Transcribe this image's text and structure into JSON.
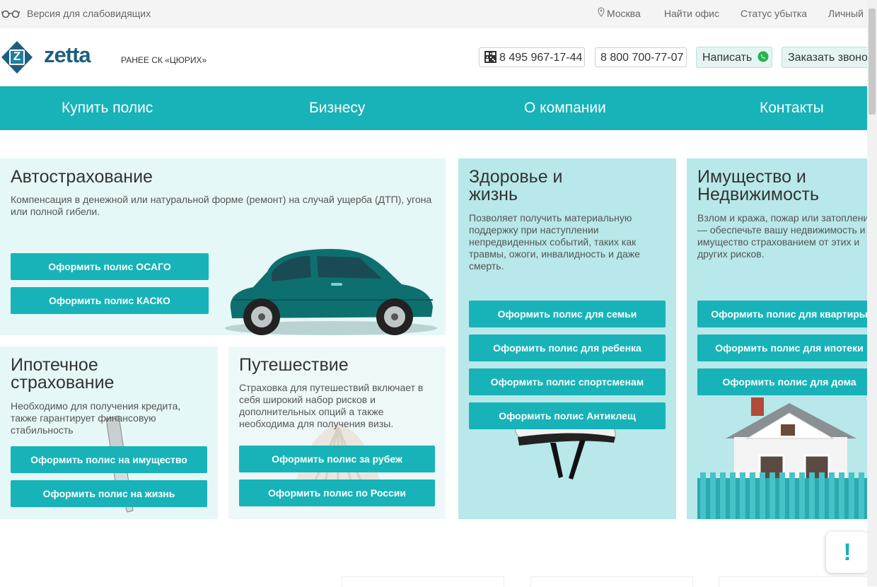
{
  "topbar": {
    "accessibility_label": "Версия для слабовидящих",
    "city": "Москва",
    "find_office": "Найти офис",
    "claim_status": "Статус убытка",
    "personal": "Личный"
  },
  "header": {
    "logo_text": "zetta",
    "logo_mark": "Z",
    "former_name": "РАНЕЕ СК «ЦЮРИХ»",
    "phone1": "8 495 967-17-44",
    "phone2": "8 800 700-77-07",
    "write_label": "Написать",
    "callback_label": "Заказать звонок"
  },
  "nav": {
    "items": [
      "Купить полис",
      "Бизнесу",
      "О компании",
      "Контакты"
    ]
  },
  "auto": {
    "title": "Автострахование",
    "desc": "Компенсация в денежной или натуральной форме (ремонт) на случай ущерба (ДТП), угона или полной гибели.",
    "btn1": "Оформить полис ОСАГО",
    "btn2": "Оформить полис КАСКО"
  },
  "health": {
    "title_line1": "Здоровье и",
    "title_line2": "жизнь",
    "desc": "Позволяет получить материальную поддержку при наступлении непредвиденных событий, таких как травмы, ожоги, инвалидность и даже смерть.",
    "btn1": "Оформить полис для семьи",
    "btn2": "Оформить полис для ребенка",
    "btn3": "Оформить полис спортсменам",
    "btn4": "Оформить полис Антиклещ"
  },
  "property": {
    "title_line1": "Имущество и",
    "title_line2": "Недвижимость",
    "desc": "Взлом и кража, пожар или затопление — обеспечьте вашу недвижимость и имущество страхованием от этих и других рисков.",
    "btn1": "Оформить полис для квартиры",
    "btn2": "Оформить полис для ипотеки",
    "btn3": "Оформить полис для дома"
  },
  "mortgage": {
    "title_line1": "Ипотечное",
    "title_line2": "страхование",
    "desc": "Необходимо для получения кредита, также гарантирует финансовую стабильность",
    "btn1": "Оформить полис на имущество",
    "btn2": "Оформить полис на жизнь"
  },
  "travel": {
    "title": "Путешествие",
    "desc": "Страховка для путешествий включает в себя широкий набор рисков и дополнительных опций а также необходима для получения визы.",
    "btn1": "Оформить полис за рубеж",
    "btn2": "Оформить полис по России"
  },
  "feedback_widget": {
    "symbol": "!"
  },
  "colors": {
    "brand_teal": "#17b3b8",
    "logo_blue": "#1e5f80",
    "card_bg_light": "#e6f7f7",
    "card_bg_teal": "#b8e8e9"
  }
}
